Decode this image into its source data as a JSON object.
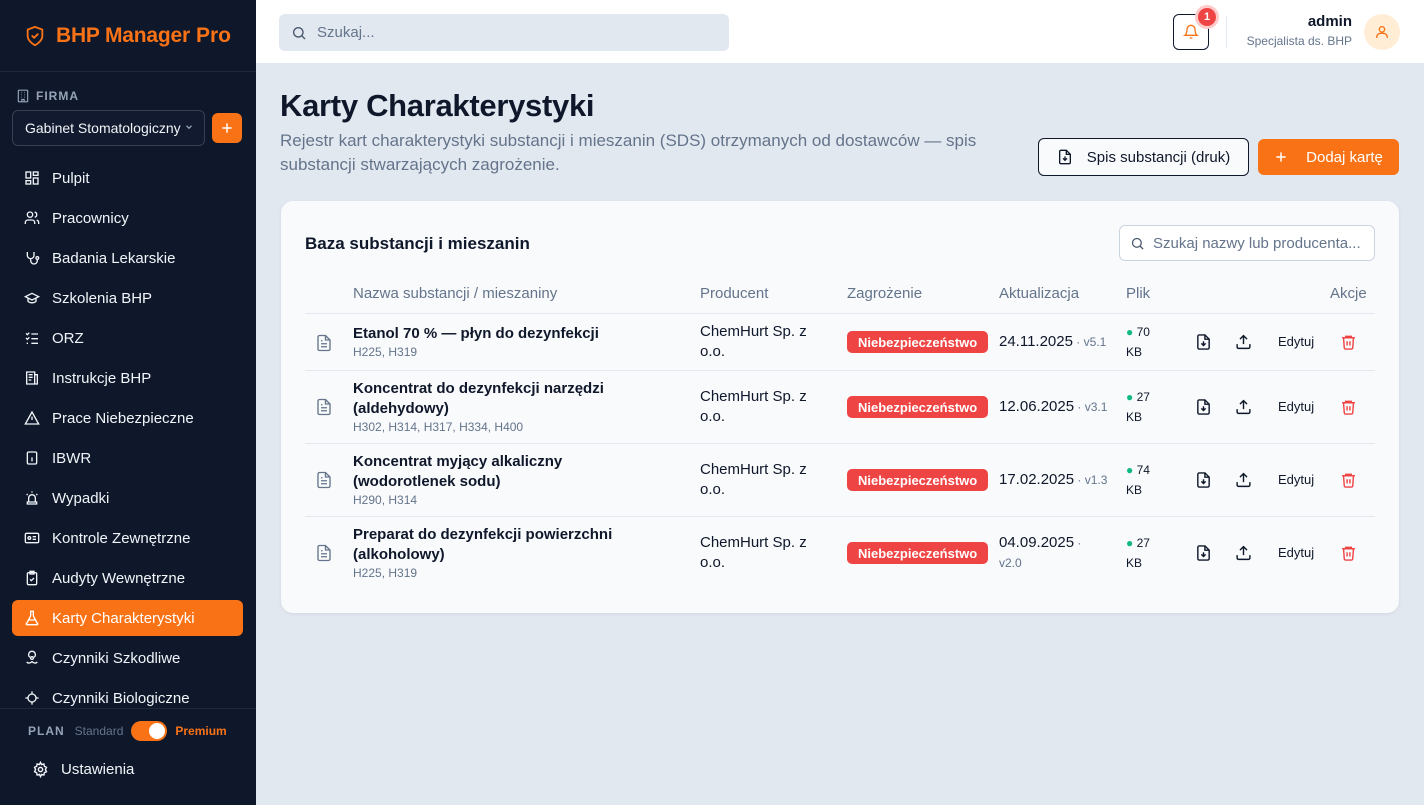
{
  "app": {
    "brand": "BHP Manager",
    "brand_suffix": "Pro"
  },
  "sidebar": {
    "firma_label": "FIRMA",
    "firma_selected": "Gabinet Stomatologiczny",
    "items": [
      {
        "label": "Pulpit",
        "icon": "dashboard-icon",
        "active": false
      },
      {
        "label": "Pracownicy",
        "icon": "users-icon",
        "active": false
      },
      {
        "label": "Badania Lekarskie",
        "icon": "stethoscope-icon",
        "active": false
      },
      {
        "label": "Szkolenia BHP",
        "icon": "graduation-cap-icon",
        "active": false
      },
      {
        "label": "ORZ",
        "icon": "checklist-icon",
        "active": false
      },
      {
        "label": "Instrukcje BHP",
        "icon": "instructions-icon",
        "active": false
      },
      {
        "label": "Prace Niebezpieczne",
        "icon": "warning-icon",
        "active": false
      },
      {
        "label": "IBWR",
        "icon": "info-file-icon",
        "active": false
      },
      {
        "label": "Wypadki",
        "icon": "siren-icon",
        "active": false
      },
      {
        "label": "Kontrole Zewnętrzne",
        "icon": "id-card-icon",
        "active": false
      },
      {
        "label": "Audyty Wewnętrzne",
        "icon": "clipboard-check-icon",
        "active": false
      },
      {
        "label": "Karty Charakterystyki",
        "icon": "flask-icon",
        "active": true
      },
      {
        "label": "Czynniki Szkodliwe",
        "icon": "biohazard-icon",
        "active": false
      },
      {
        "label": "Czynniki Biologiczne",
        "icon": "microbe-icon",
        "active": false
      }
    ],
    "plan_label": "PLAN",
    "plan_standard": "Standard",
    "plan_premium": "Premium",
    "settings_label": "Ustawienia"
  },
  "topbar": {
    "search_placeholder": "Szukaj...",
    "notifications_count": "1",
    "user_name": "admin",
    "user_role": "Specjalista ds. BHP"
  },
  "page": {
    "title": "Karty Charakterystyki",
    "description": "Rejestr kart charakterystyki substancji i mieszanin (SDS) otrzymanych od dostawców — spis substancji stwarzających zagrożenie.",
    "btn_print": "Spis substancji (druk)",
    "btn_add": "Dodaj kartę"
  },
  "table": {
    "title": "Baza substancji i mieszanin",
    "search_placeholder": "Szukaj nazwy lub producenta...",
    "columns": {
      "name": "Nazwa substancji / mieszaniny",
      "producer": "Producent",
      "hazard": "Zagrożenie",
      "updated": "Aktualizacja",
      "file": "Plik",
      "actions": "Akcje"
    },
    "edit_label": "Edytuj",
    "rows": [
      {
        "name": "Etanol 70 % — płyn do dezynfekcji",
        "codes": "H225, H319",
        "producer": "ChemHurt Sp. z o.o.",
        "hazard": "Niebezpieczeństwo",
        "date": "24.11.2025",
        "version": "v5.1",
        "size": "70",
        "unit": "KB"
      },
      {
        "name": "Koncentrat do dezynfekcji narzędzi (aldehydowy)",
        "codes": "H302, H314, H317, H334, H400",
        "producer": "ChemHurt Sp. z o.o.",
        "hazard": "Niebezpieczeństwo",
        "date": "12.06.2025",
        "version": "v3.1",
        "size": "27",
        "unit": "KB"
      },
      {
        "name": "Koncentrat myjący alkaliczny (wodorotlenek sodu)",
        "codes": "H290, H314",
        "producer": "ChemHurt Sp. z o.o.",
        "hazard": "Niebezpieczeństwo",
        "date": "17.02.2025",
        "version": "v1.3",
        "size": "74",
        "unit": "KB"
      },
      {
        "name": "Preparat do dezynfekcji powierzchni (alkoholowy)",
        "codes": "H225, H319",
        "producer": "ChemHurt Sp. z o.o.",
        "hazard": "Niebezpieczeństwo",
        "date": "04.09.2025",
        "version": "v2.0",
        "size": "27",
        "unit": "KB"
      }
    ]
  },
  "colors": {
    "accent": "#f97316",
    "sidebar_bg": "#0f172a",
    "danger": "#ef4444",
    "success": "#10b981"
  }
}
